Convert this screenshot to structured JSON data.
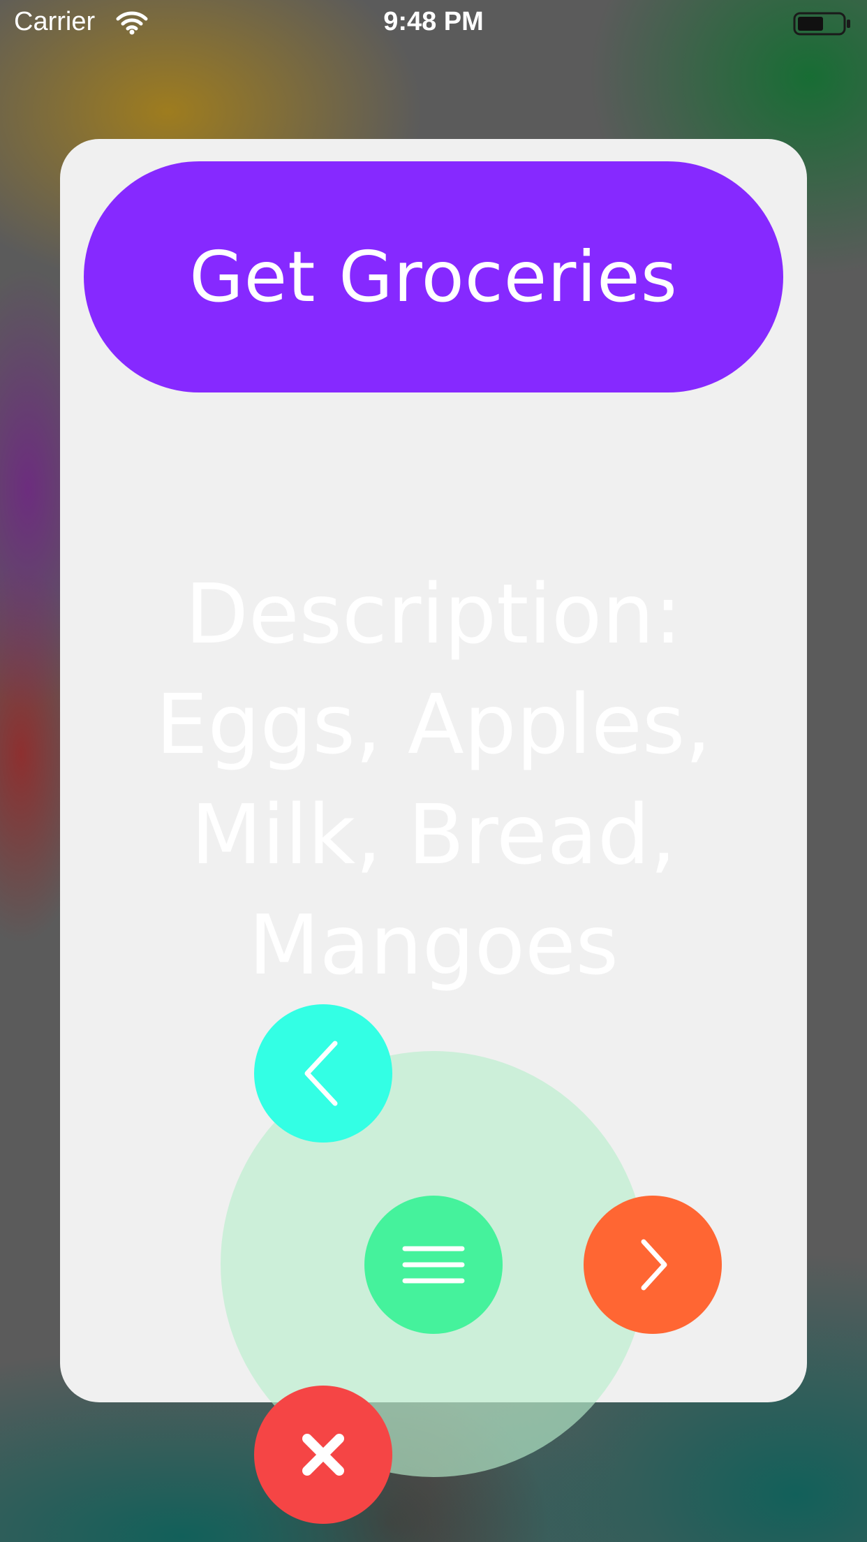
{
  "status_bar": {
    "carrier": "Carrier",
    "time": "9:48 PM",
    "icons": [
      "wifi-icon",
      "battery-icon"
    ]
  },
  "card": {
    "title": "Get Groceries",
    "description": "Description: Eggs, Apples, Milk, Bread, Mangoes"
  },
  "fab_menu": {
    "buttons": [
      {
        "name": "back-button",
        "icon": "chevron-left-icon",
        "color": "#33ffe4"
      },
      {
        "name": "menu-button",
        "icon": "hamburger-menu-icon",
        "color": "#45f29c"
      },
      {
        "name": "next-button",
        "icon": "chevron-right-icon",
        "color": "#ff6633"
      },
      {
        "name": "close-button",
        "icon": "close-icon",
        "color": "#f54545"
      }
    ]
  },
  "colors": {
    "accent_purple": "#8629ff",
    "card_background": "#f0f0f0"
  }
}
